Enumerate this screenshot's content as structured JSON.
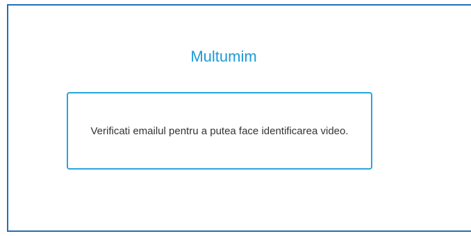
{
  "page": {
    "title": "Multumim",
    "message": "Verificati emailul pentru a putea face identificarea video."
  },
  "colors": {
    "title": "#1b9ad7",
    "frame_border": "#1f6fb5",
    "box_border": "#29a3dc",
    "text": "#333333"
  }
}
